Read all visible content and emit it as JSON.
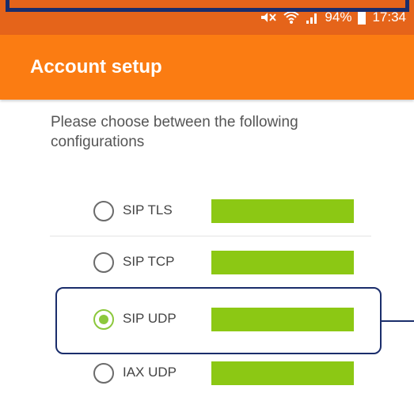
{
  "status_bar": {
    "battery": "94%",
    "time": "17:34",
    "icons": [
      "mute-icon",
      "wifi-icon",
      "signal-icon",
      "battery-icon"
    ]
  },
  "app_bar": {
    "title": "Account setup"
  },
  "instructions": "Please choose between the following configurations",
  "options": [
    {
      "label": "SIP TLS",
      "selected": false
    },
    {
      "label": "SIP TCP",
      "selected": false
    },
    {
      "label": "SIP UDP",
      "selected": true
    },
    {
      "label": "IAX UDP",
      "selected": false
    }
  ],
  "colors": {
    "status_bar": "#e5641a",
    "app_bar": "#fb7c12",
    "accent": "#8cc83c",
    "annotation": "#1a2d6b"
  }
}
